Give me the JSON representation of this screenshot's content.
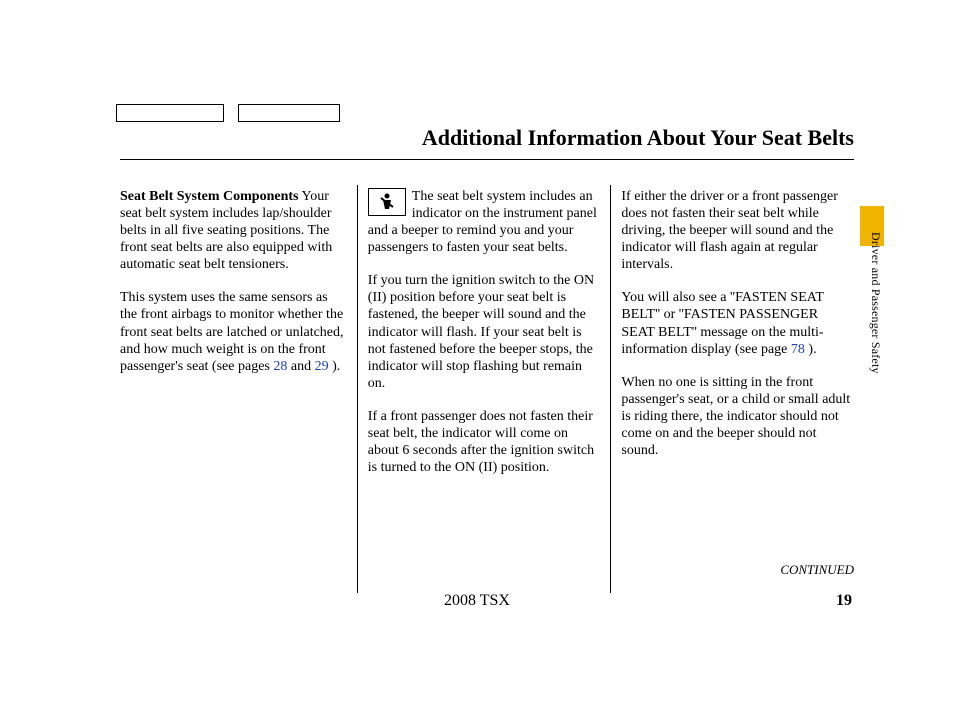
{
  "title": "Additional Information About Your Seat Belts",
  "side_text": "Driver and Passenger Safety",
  "col1": {
    "subhead": "Seat Belt System Components",
    "p1": "Your seat belt system includes lap/shoulder belts in all five seating positions. The front seat belts are also equipped with automatic seat belt tensioners.",
    "p2a": "This system uses the same sensors as the front airbags to monitor whether the front seat belts are latched or unlatched, and how much weight is on the front passenger's seat (see pages ",
    "link28": "28",
    "and": " and ",
    "link29": "29",
    "p2b": " )."
  },
  "col2": {
    "icon_glyph": "⚠",
    "icon_name": "seatbelt-indicator-icon",
    "p1": "The seat belt system includes an indicator on the instrument panel and a beeper to remind you and your passengers to fasten your seat belts.",
    "p2": "If you turn the ignition switch to the ON (II) position before your seat belt is fastened, the beeper will sound and the indicator will flash. If your seat belt is not fastened before the beeper stops, the indicator will stop flashing but remain on.",
    "p3": "If a front passenger does not fasten their seat belt, the indicator will come on about 6 seconds after the ignition switch is turned to the ON (II) position."
  },
  "col3": {
    "p1": "If either the driver or a front passenger does not fasten their seat belt while driving, the beeper will sound and the indicator will flash again at regular intervals.",
    "p2a": "You will also see a ''FASTEN SEAT BELT'' or ''FASTEN PASSENGER SEAT BELT'' message on the multi-information display (see page ",
    "link78": "78",
    "p2b": " ).",
    "p3": "When no one is sitting in the front passenger's seat, or a child or small adult is riding there, the indicator should not come on and the beeper should not sound."
  },
  "continued": "CONTINUED",
  "footer_model": "2008  TSX",
  "footer_page": "19"
}
